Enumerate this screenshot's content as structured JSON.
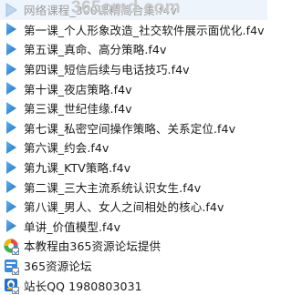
{
  "watermark": "365cmd.com",
  "files": [
    {
      "name": "网络课程_300课精简合集.f4v",
      "icon": "play-icon"
    },
    {
      "name": "第一课_个人形象改造_社交软件展示面优化.f4v",
      "icon": "play-icon"
    },
    {
      "name": "第五课_真命、高分策略.f4v",
      "icon": "play-icon"
    },
    {
      "name": "第四课_短信后续与电话技巧.f4v",
      "icon": "play-icon"
    },
    {
      "name": "第十课_夜店策略.f4v",
      "icon": "play-icon"
    },
    {
      "name": "第三课_世纪佳缘.f4v",
      "icon": "play-icon"
    },
    {
      "name": "第七课_私密空间操作策略、关系定位.f4v",
      "icon": "play-icon"
    },
    {
      "name": "第六课_约会.f4v",
      "icon": "play-icon"
    },
    {
      "name": "第九课_KTV策略.f4v",
      "icon": "play-icon"
    },
    {
      "name": "第二课_三大主流系统认识女生.f4v",
      "icon": "play-icon"
    },
    {
      "name": "第八课_男人、女人之间相处的核心.f4v",
      "icon": "play-icon"
    },
    {
      "name": "单讲_价值模型.f4v",
      "icon": "play-icon"
    }
  ],
  "links": [
    {
      "name": "本教程由365资源论坛提供",
      "icon": "shortcut-icon"
    },
    {
      "name": "365资源论坛",
      "icon": "shortcut-icon"
    },
    {
      "name": "站长QQ 1980803031",
      "icon": "shortcut-icon"
    }
  ],
  "colors": {
    "play": "#2a7fd4",
    "play_light": "#4aa3ea"
  }
}
